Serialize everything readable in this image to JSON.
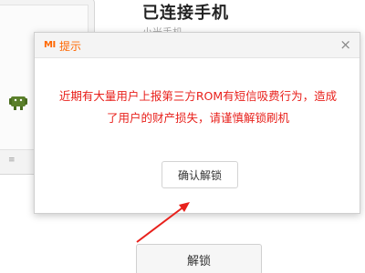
{
  "background": {
    "status_title": "已连接手机",
    "status_subtitle": "小米手机",
    "unlock_label": "解锁",
    "home_glyph": "≡",
    "robot_icon": "android-robot-icon"
  },
  "dialog": {
    "logo_text": "MI",
    "title": "提示",
    "close_glyph": "×",
    "message": "近期有大量用户上报第三方ROM有短信吸费行为，造成了用户的财产损失，请谨慎解锁刷机",
    "confirm_label": "确认解锁"
  },
  "colors": {
    "brand_orange": "#ff6700",
    "warning_red": "#e8211c",
    "annotation_arrow": "#e8211c"
  }
}
